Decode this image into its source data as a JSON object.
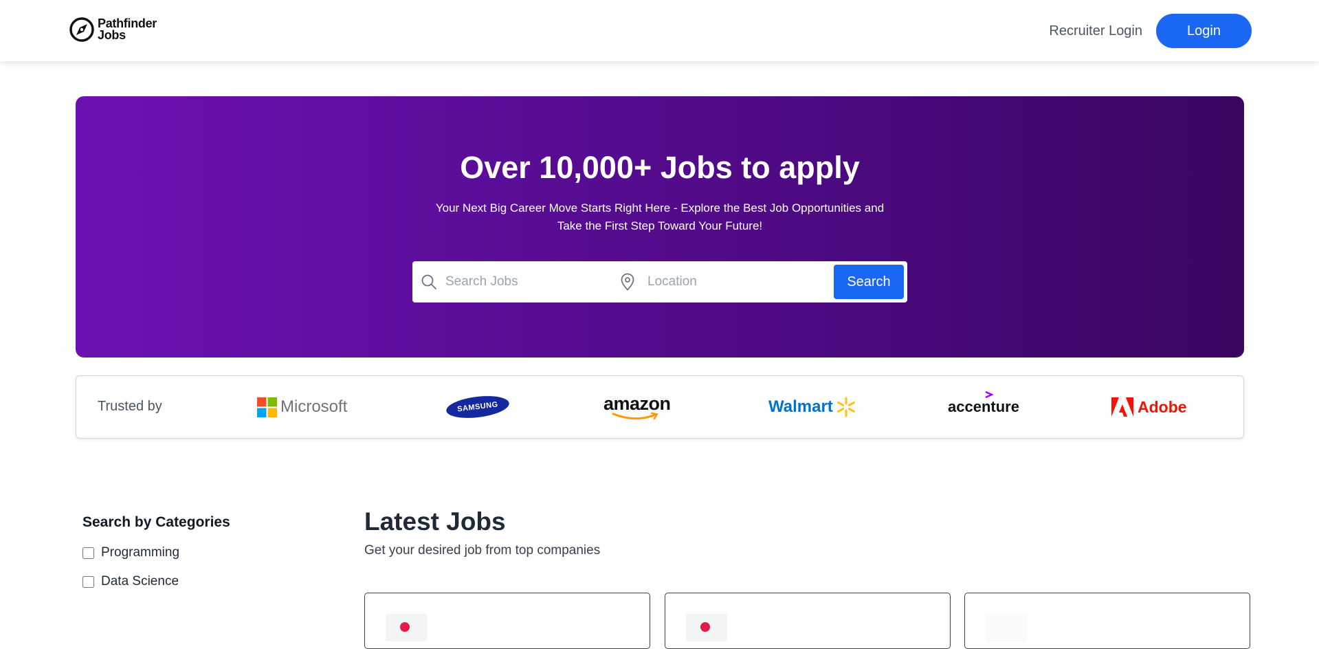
{
  "header": {
    "logo_line1": "Pathfinder",
    "logo_line2": "Jobs",
    "recruiter_login": "Recruiter Login",
    "login": "Login"
  },
  "hero": {
    "title": "Over 10,000+ Jobs to apply",
    "subtitle": "Your Next Big Career Move Starts Right Here - Explore the Best Job Opportunities and Take the First Step Toward Your Future!",
    "search_placeholder": "Search Jobs",
    "location_placeholder": "Location",
    "search_button": "Search"
  },
  "trusted": {
    "label": "Trusted by",
    "brands": [
      "Microsoft",
      "SAMSUNG",
      "amazon",
      "Walmart",
      "accenture",
      "Adobe"
    ]
  },
  "categories": {
    "title": "Search by Categories",
    "items": [
      {
        "label": "Programming",
        "checked": false
      },
      {
        "label": "Data Science",
        "checked": false
      }
    ]
  },
  "latest": {
    "title": "Latest Jobs",
    "subtitle": "Get your desired job from top companies"
  },
  "colors": {
    "primary": "#1967f3",
    "hero_start": "#6c12b2",
    "hero_end": "#3b0561"
  }
}
